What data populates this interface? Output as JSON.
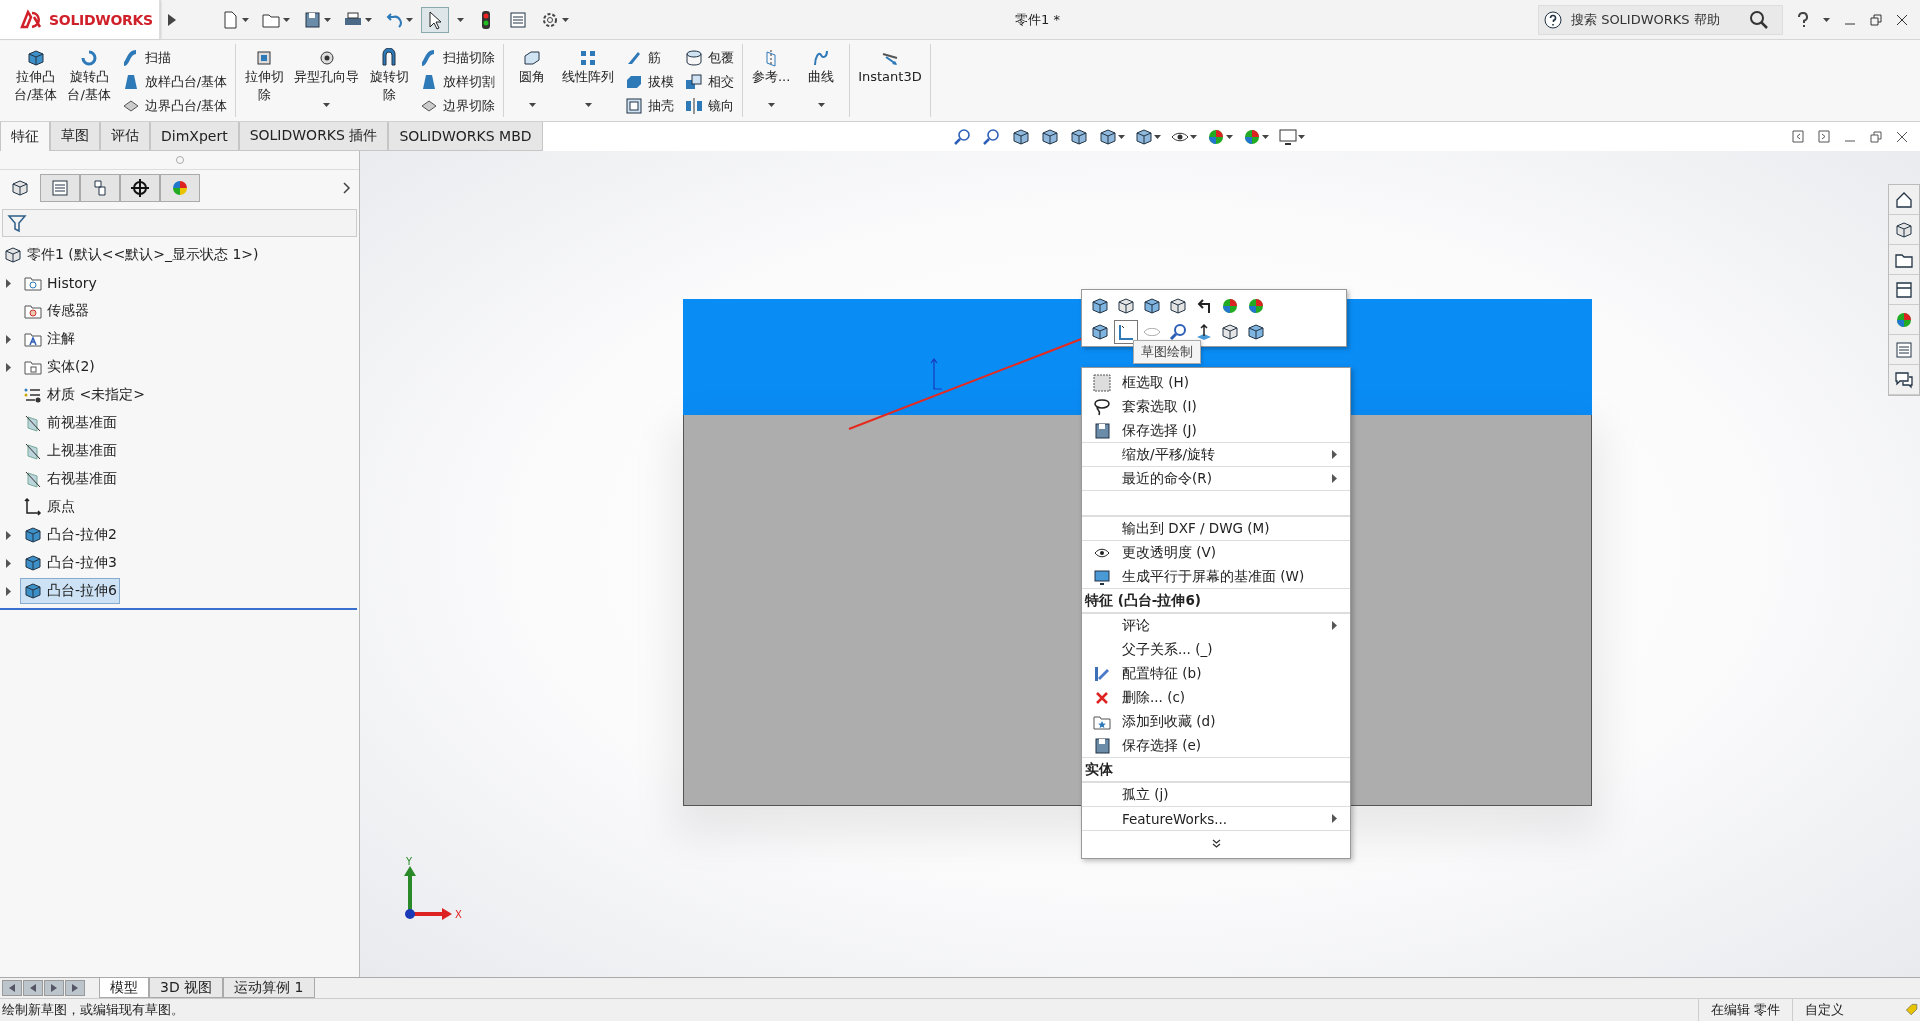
{
  "window": {
    "logo": "SOLIDWORKS",
    "title": "零件1 *",
    "search_placeholder": "搜索 SOLIDWORKS 帮助"
  },
  "ribbon": [
    {
      "tools": [
        {
          "kind": "large",
          "lines": [
            "拉伸凸",
            "台/基体"
          ],
          "dropdown": false
        },
        {
          "kind": "large",
          "lines": [
            "旋转凸",
            "台/基体"
          ],
          "dropdown": false
        },
        {
          "kind": "stack",
          "items": [
            "扫描",
            "放样凸台/基体",
            "边界凸台/基体"
          ]
        }
      ]
    },
    {
      "tools": [
        {
          "kind": "large",
          "lines": [
            "拉伸切",
            "除"
          ],
          "dropdown": false
        },
        {
          "kind": "large",
          "lines": [
            "异型孔向导"
          ],
          "dropdown": true
        },
        {
          "kind": "large",
          "lines": [
            "旋转切",
            "除"
          ],
          "dropdown": false
        },
        {
          "kind": "stack",
          "items": [
            "扫描切除",
            "放样切割",
            "边界切除"
          ]
        }
      ]
    },
    {
      "tools": [
        {
          "kind": "large",
          "lines": [
            "圆角"
          ],
          "dropdown": true
        },
        {
          "kind": "large",
          "lines": [
            "线性阵列"
          ],
          "dropdown": true
        },
        {
          "kind": "stack",
          "items": [
            "筋",
            "拔模",
            "抽壳"
          ]
        },
        {
          "kind": "stack",
          "items": [
            "包覆",
            "相交",
            "镜向"
          ]
        }
      ]
    },
    {
      "tools": [
        {
          "kind": "large",
          "lines": [
            "参考..."
          ],
          "dropdown": true
        },
        {
          "kind": "large",
          "lines": [
            "曲线"
          ],
          "dropdown": true
        }
      ]
    },
    {
      "tools": [
        {
          "kind": "large",
          "lines": [
            "Instant3D"
          ],
          "dropdown": false
        }
      ]
    }
  ],
  "command_tabs": [
    {
      "label": "特征",
      "selected": true
    },
    {
      "label": "草图",
      "selected": false
    },
    {
      "label": "评估",
      "selected": false
    },
    {
      "label": "DimXpert",
      "selected": false
    },
    {
      "label": "SOLIDWORKS 插件",
      "selected": false
    },
    {
      "label": "SOLIDWORKS MBD",
      "selected": false
    }
  ],
  "panel_tabs": [
    {
      "kind": "tree",
      "selected": true
    },
    {
      "kind": "property",
      "selected": false
    },
    {
      "kind": "config",
      "selected": false
    },
    {
      "kind": "target",
      "selected": false
    },
    {
      "kind": "appearance",
      "selected": false
    }
  ],
  "tree": {
    "root": "零件1  (默认<<默认>_显示状态 1>)",
    "items": [
      {
        "label": "History",
        "kind": "history",
        "expandable": true,
        "selected": false
      },
      {
        "label": "传感器",
        "kind": "sensor",
        "expandable": false,
        "selected": false
      },
      {
        "label": "注解",
        "kind": "annotation",
        "expandable": true,
        "selected": false
      },
      {
        "label": "实体(2)",
        "kind": "solid",
        "expandable": true,
        "selected": false
      },
      {
        "label": "材质 <未指定>",
        "kind": "material",
        "expandable": false,
        "selected": false
      },
      {
        "label": "前视基准面",
        "kind": "plane",
        "expandable": false,
        "selected": false
      },
      {
        "label": "上视基准面",
        "kind": "plane",
        "expandable": false,
        "selected": false
      },
      {
        "label": "右视基准面",
        "kind": "plane",
        "expandable": false,
        "selected": false
      },
      {
        "label": "原点",
        "kind": "origin",
        "expandable": false,
        "selected": false
      },
      {
        "label": "凸台-拉伸2",
        "kind": "feature",
        "expandable": true,
        "selected": false
      },
      {
        "label": "凸台-拉伸3",
        "kind": "feature",
        "expandable": true,
        "selected": false
      },
      {
        "label": "凸台-拉伸6",
        "kind": "feature",
        "expandable": true,
        "selected": true
      }
    ]
  },
  "tooltip": "草图绘制",
  "context_menu": [
    {
      "kind": "item",
      "label": "框选取 (H)",
      "submenu": false,
      "divider": false
    },
    {
      "kind": "item",
      "label": "套索选取 (I)",
      "submenu": false,
      "divider": false
    },
    {
      "kind": "item",
      "label": "保存选择 (J)",
      "submenu": false,
      "divider": false
    },
    {
      "kind": "item",
      "label": "缩放/平移/旋转",
      "submenu": true,
      "divider": true
    },
    {
      "kind": "item",
      "label": "最近的命令(R)",
      "submenu": true,
      "divider": true
    },
    {
      "kind": "blank",
      "divider": true
    },
    {
      "kind": "item",
      "label": "输出到 DXF / DWG (M)",
      "submenu": false,
      "divider": true
    },
    {
      "kind": "item",
      "label": "更改透明度 (V)",
      "submenu": false,
      "divider": true
    },
    {
      "kind": "item",
      "label": "生成平行于屏幕的基准面 (W)",
      "submenu": false,
      "divider": false
    },
    {
      "kind": "header",
      "label": "特征 (凸台-拉伸6)",
      "divider": true
    },
    {
      "kind": "item",
      "label": "评论",
      "submenu": true,
      "divider": true
    },
    {
      "kind": "item",
      "label": "父子关系... (_)",
      "submenu": false,
      "divider": false
    },
    {
      "kind": "item",
      "label": "配置特征 (b)",
      "submenu": false,
      "divider": false
    },
    {
      "kind": "item",
      "label": "删除... (c)",
      "submenu": false,
      "divider": false
    },
    {
      "kind": "item",
      "label": "添加到收藏 (d)",
      "submenu": false,
      "divider": false
    },
    {
      "kind": "item",
      "label": "保存选择 (e)",
      "submenu": false,
      "divider": false
    },
    {
      "kind": "header",
      "label": "实体",
      "divider": true
    },
    {
      "kind": "item",
      "label": "孤立 (j)",
      "submenu": false,
      "divider": true
    },
    {
      "kind": "item",
      "label": "FeatureWorks...",
      "submenu": true,
      "divider": true
    },
    {
      "kind": "more",
      "divider": true
    }
  ],
  "triad": {
    "y": "Y",
    "x": "X"
  },
  "view_tabs": [
    {
      "label": "模型",
      "selected": true
    },
    {
      "label": "3D 视图",
      "selected": false
    },
    {
      "label": "运动算例 1",
      "selected": false
    }
  ],
  "status_bar": {
    "message": "绘制新草图，或编辑现有草图。",
    "mode": "在编辑 零件",
    "units": "自定义"
  }
}
